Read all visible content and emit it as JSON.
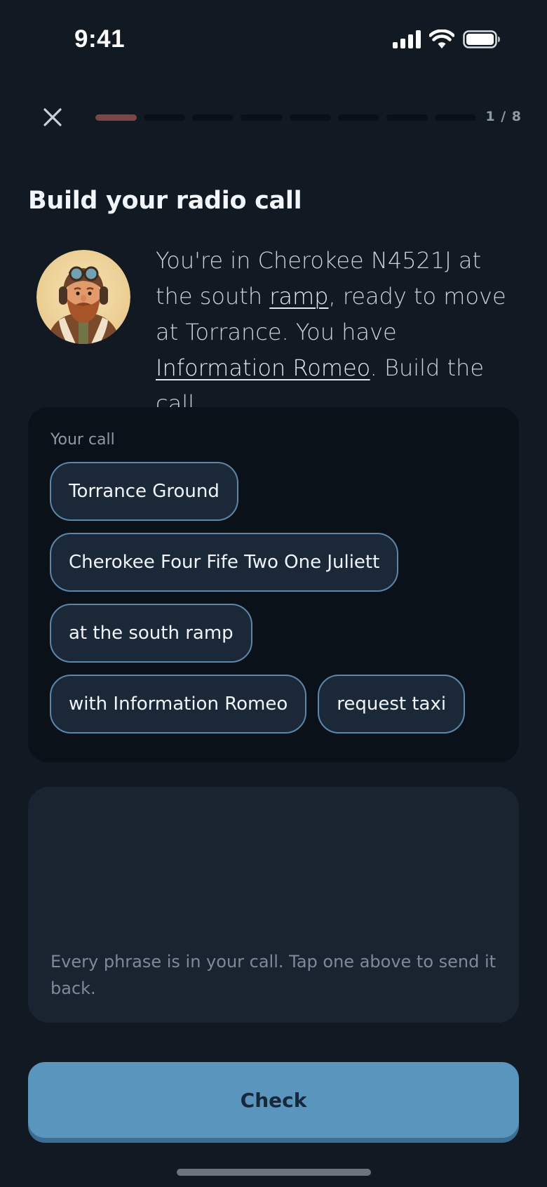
{
  "status_bar": {
    "time": "9:41",
    "icons": [
      "cellular-signal-icon",
      "wifi-icon",
      "battery-icon"
    ]
  },
  "header": {
    "close_icon": "close-icon",
    "progress": {
      "current": 1,
      "total": 8
    },
    "progress_label": "1 / 8"
  },
  "title": "Build your radio call",
  "prompt": {
    "avatar": "pilot-avatar",
    "text_1": "You're in Cherokee N4521J at the south ",
    "link_1": "ramp",
    "text_2": ", ready to move at Torrance. You have ",
    "link_2": "Information Romeo",
    "text_3": ". Build the call."
  },
  "call": {
    "label": "Your call",
    "phrases": [
      "Torrance Ground",
      "Cherokee Four Fife Two One Juliett",
      "at the south ramp",
      "with Information Romeo",
      "request taxi"
    ]
  },
  "bank": {
    "hint": "Every phrase is in your call. Tap one above to send it back."
  },
  "check_button": "Check",
  "colors": {
    "background": "#111923",
    "accent": "#5a95be",
    "progress_active": "#7d4645",
    "chip_border": "#5b87ab"
  }
}
